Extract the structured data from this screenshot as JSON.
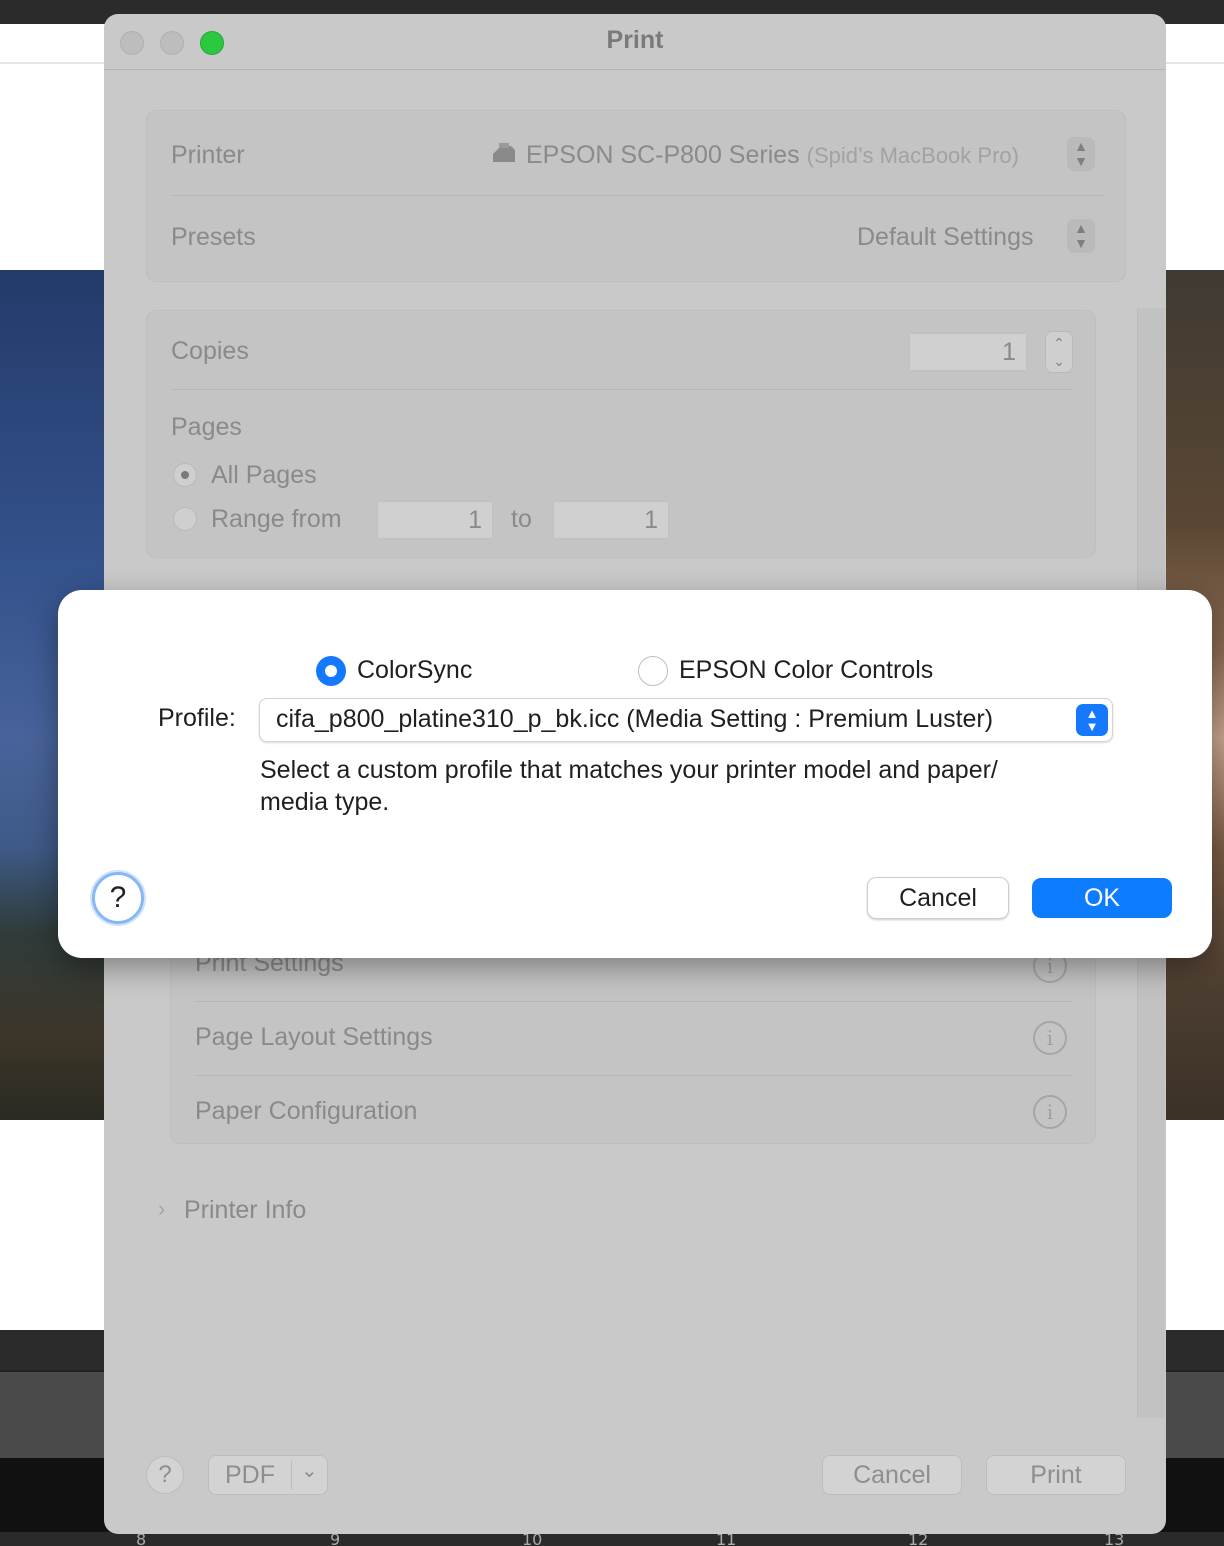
{
  "window": {
    "title": "Print"
  },
  "printer_group": {
    "printer_label": "Printer",
    "printer_name": "EPSON SC-P800 Series",
    "printer_host": "(Spid’s MacBook Pro)",
    "presets_label": "Presets",
    "presets_value": "Default Settings"
  },
  "copies_group": {
    "copies_label": "Copies",
    "copies_value": "1",
    "pages_label": "Pages",
    "all_pages_label": "All Pages",
    "range_from_label": "Range from",
    "range_from_value": "1",
    "range_to_label": "to",
    "range_to_value": "1"
  },
  "settings_list": {
    "items": [
      {
        "label": "Print Settings"
      },
      {
        "label": "Page Layout Settings"
      },
      {
        "label": "Paper Configuration"
      }
    ],
    "info_icon_glyph": "i"
  },
  "printer_info": {
    "label": "Printer Info",
    "chevron": "›"
  },
  "bottom_bar": {
    "help": "?",
    "pdf": "PDF",
    "pdf_chevron": "⌄",
    "cancel": "Cancel",
    "print": "Print"
  },
  "sheet": {
    "option_colorsync": "ColorSync",
    "option_epson": "EPSON Color Controls",
    "selected_option": "ColorSync",
    "profile_label": "Profile:",
    "profile_value": "cifa_p800_platine310_p_bk.icc (Media Setting : Premium Luster)",
    "description_line1": "Select a custom profile that matches your printer model and paper/",
    "description_line2": "media type.",
    "help": "?",
    "cancel": "Cancel",
    "ok": "OK",
    "accent_color": "#0d7cff"
  },
  "background_ruler": [
    "8",
    "9",
    "10",
    "11",
    "12",
    "13"
  ]
}
